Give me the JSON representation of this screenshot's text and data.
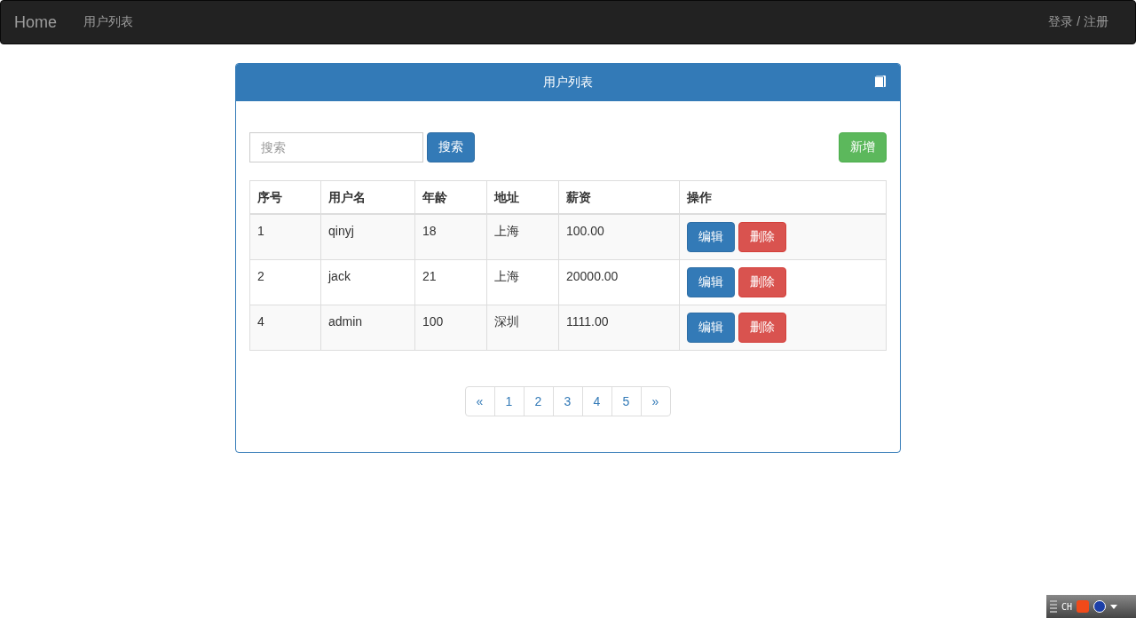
{
  "navbar": {
    "brand": "Home",
    "links": [
      "用户列表"
    ],
    "right_link": "登录 / 注册"
  },
  "panel": {
    "title": "用户列表",
    "search": {
      "placeholder": "搜索",
      "button": "搜索"
    },
    "add_button": "新增",
    "table": {
      "columns": [
        "序号",
        "用户名",
        "年龄",
        "地址",
        "薪资",
        "操作"
      ],
      "rows": [
        {
          "cells": [
            "1",
            "qinyj",
            "18",
            "上海",
            "100.00"
          ],
          "actions": [
            "编辑",
            "删除"
          ]
        },
        {
          "cells": [
            "2",
            "jack",
            "21",
            "上海",
            "20000.00"
          ],
          "actions": [
            "编辑",
            "删除"
          ]
        },
        {
          "cells": [
            "4",
            "admin",
            "100",
            "深圳",
            "1111.00"
          ],
          "actions": [
            "编辑",
            "删除"
          ]
        }
      ]
    },
    "pagination": [
      "«",
      "1",
      "2",
      "3",
      "4",
      "5",
      "»"
    ]
  },
  "tray": {
    "label": "CH"
  }
}
